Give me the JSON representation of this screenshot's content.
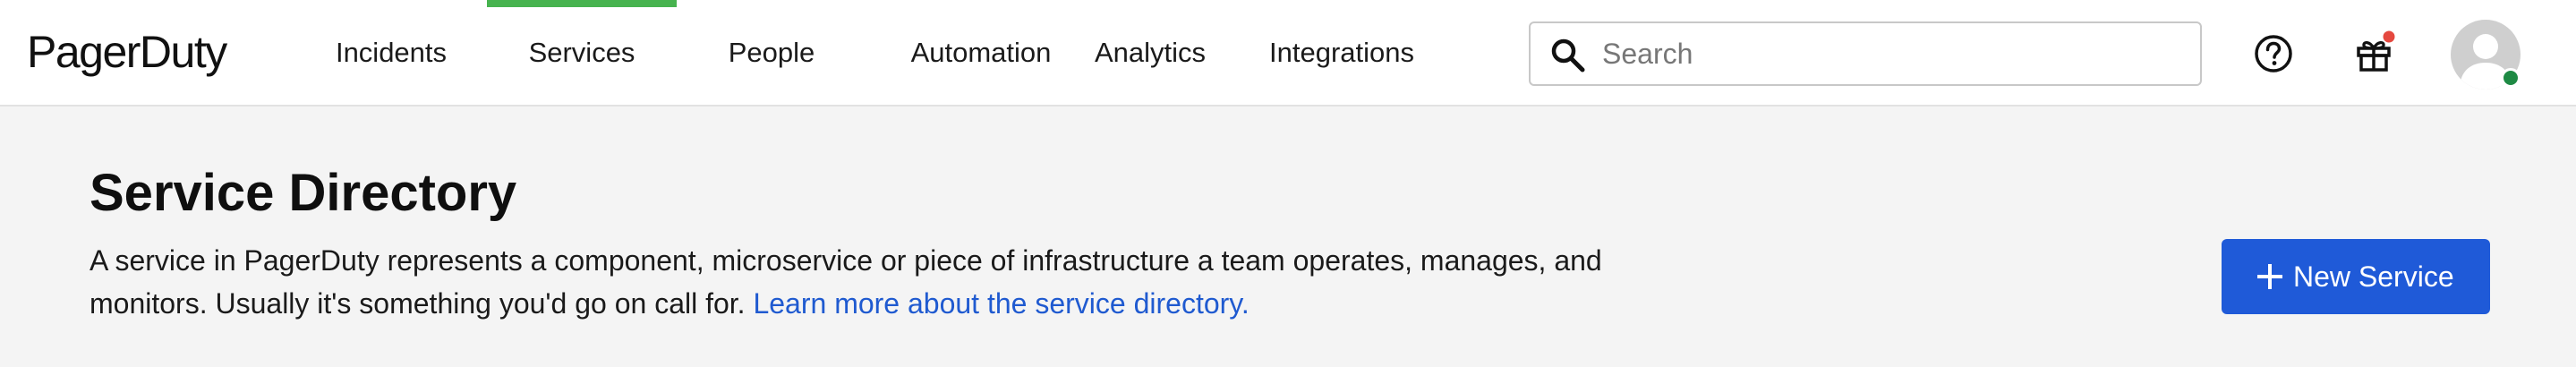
{
  "header": {
    "logo_text": "PagerDuty",
    "nav": [
      {
        "label": "Incidents",
        "active": false
      },
      {
        "label": "Services",
        "active": true
      },
      {
        "label": "People",
        "active": false
      },
      {
        "label": "Automation",
        "active": false
      },
      {
        "label": "Analytics",
        "active": false
      },
      {
        "label": "Integrations",
        "active": false
      }
    ],
    "search": {
      "placeholder": "Search",
      "value": "",
      "icon": "search-icon"
    },
    "help_icon": "question-circle-icon",
    "gift_icon": "gift-icon",
    "notification_dot_color": "#e5483f",
    "avatar_status_color": "#1e8a44"
  },
  "page": {
    "title": "Service Directory",
    "description": "A service in PagerDuty represents a component, microservice or piece of infrastructure a team operates, manages, and monitors. Usually it's something you'd go on call for.",
    "learn_more_link": "Learn more about the service directory.",
    "new_service_button": "New Service"
  },
  "colors": {
    "active_tab": "#47b34f",
    "primary_button": "#1f5ad8",
    "link": "#1f5ad0"
  }
}
